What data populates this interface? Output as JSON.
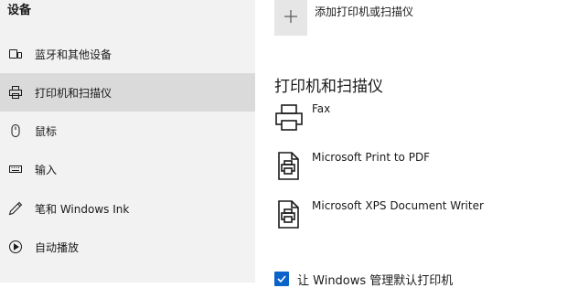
{
  "sidebar": {
    "title": "设备",
    "items": [
      {
        "label": "蓝牙和其他设备",
        "icon": "devices-icon"
      },
      {
        "label": "打印机和扫描仪",
        "icon": "printer-icon",
        "selected": true
      },
      {
        "label": "鼠标",
        "icon": "mouse-icon"
      },
      {
        "label": "输入",
        "icon": "keyboard-icon"
      },
      {
        "label": "笔和 Windows Ink",
        "icon": "pen-icon"
      },
      {
        "label": "自动播放",
        "icon": "autoplay-icon"
      }
    ]
  },
  "main": {
    "add_label": "添加打印机或扫描仪",
    "section_title": "打印机和扫描仪",
    "devices": [
      {
        "name": "Fax",
        "icon": "fax-icon"
      },
      {
        "name": "Microsoft Print to PDF",
        "icon": "printer-icon"
      },
      {
        "name": "Microsoft XPS Document Writer",
        "icon": "printer-icon"
      }
    ],
    "default_printer_checkbox": {
      "label": "让 Windows 管理默认打印机",
      "checked": true
    }
  },
  "colors": {
    "accent": "#0a63c9",
    "sidebar_bg": "#f2f2f2",
    "selected_bg": "#dadada"
  }
}
